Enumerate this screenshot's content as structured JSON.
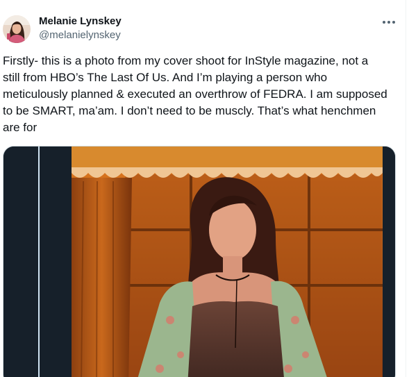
{
  "author": {
    "display_name": "Melanie Lynskey",
    "handle": "@melanielynskey",
    "avatar_icon": "profile-photo"
  },
  "menu": {
    "icon": "more-horizontal-icon"
  },
  "tweet": {
    "text": "Firstly- this is a photo from my cover shoot for InStyle magazine, not a\nstill from HBO’s The Last Of Us. And I’m playing a person who\nmeticulously planned & executed an overthrow of FEDRA. I am supposed\nto be SMART, ma’am. I don’t need to be muscly. That’s what henchmen\nare for"
  },
  "media": {
    "type": "photo",
    "colors": {
      "frame": "#16202a",
      "backdrop": "#e0701a",
      "curtain": "#b55a14",
      "accent_line": "#cfe3f2"
    }
  }
}
